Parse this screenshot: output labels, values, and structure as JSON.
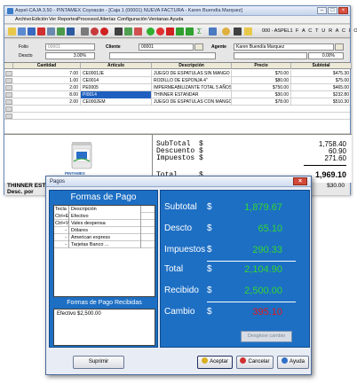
{
  "main_window": {
    "title": "Aspel-CAJA 3.50 - PINTAMEX Coyoacán - [Caja 1 (00001) NUEVA FACTURA - Karen Buendía Marquez]",
    "menu": [
      "Archivo",
      "Edición",
      "Ver",
      "Reportes",
      "Procesos",
      "Utilerías",
      "Configuración",
      "Ventanas",
      "Ayuda"
    ],
    "toolbar": {
      "caja_label": "000 - ASPEL1",
      "doc_type": "F A C T U R A C I O N"
    },
    "form": {
      "folio_label": "Folio",
      "folio_value": "00001",
      "cliente_label": "Cliente",
      "cliente_value": "00001",
      "agente_label": "Agente",
      "agente_value": "Karen Buendía Marquez",
      "descuento_label": "Descto",
      "descuento_value": "3.00%",
      "impuesto_value": "0.00%"
    },
    "grid": {
      "columns": [
        "Cantidad",
        "Artículo",
        "Descripción",
        "Precio",
        "Subtotal"
      ],
      "rows": [
        {
          "cantidad": "7.00",
          "articulo": "CE0001JE",
          "descripcion": "JUEGO DE ESPATULAS SIN MANGO",
          "precio": "$70.00",
          "subtotal": "$475.30"
        },
        {
          "cantidad": "1.00",
          "articulo": "CE0014",
          "descripcion": "RODILLO DE ESPONJA 4\"",
          "precio": "$80.00",
          "subtotal": "$75.00"
        },
        {
          "cantidad": "2.00",
          "articulo": "PE0005",
          "descripcion": "IMPERMEABILIZANTE TOTAL 5 AÑOS",
          "precio": "$750.00",
          "subtotal": "$465.00"
        },
        {
          "cantidad": "8.00",
          "articulo": "PI0014",
          "descripcion": "THINNER ESTANDAR",
          "precio": "$30.00",
          "subtotal": "$232.80"
        },
        {
          "cantidad": "2.00",
          "articulo": "CE0002EM",
          "descripcion": "JUEGO DE ESPATULAS CON MANGO",
          "precio": "$78.00",
          "subtotal": "$510.30"
        }
      ]
    },
    "image_label": "PINTAMEX",
    "totals": {
      "subtotal_label": "SubTotal",
      "subtotal_value": "1,758.40",
      "descuento_label": "Descuento",
      "descuento_value": "60.90",
      "impuestos_label": "Impuestos",
      "impuestos_value": "271.60",
      "total_label": "Total",
      "total_value": "1,969.10",
      "currency": "$"
    },
    "status": {
      "product": "THINNER ESTANDAR",
      "desc": "Desc. por",
      "price": "$30.00"
    }
  },
  "pagos": {
    "title": "Pagos",
    "formas_title": "Formas de Pago",
    "table_head": {
      "tecla": "Tecla",
      "descripcion": "Descripción"
    },
    "formas": [
      {
        "tecla": "Ctrl+E",
        "descripcion": "Efectivo"
      },
      {
        "tecla": "Ctrl+V",
        "descripcion": "Vales despensa"
      },
      {
        "tecla": "-",
        "descripcion": "Dólares"
      },
      {
        "tecla": "-",
        "descripcion": "American express"
      },
      {
        "tecla": "-",
        "descripcion": "Tarjetas Banco ..."
      }
    ],
    "recibidas_title": "Formas de Pago Recibidas",
    "recibidas_entry": "Efectivo $2,500.00",
    "summary": {
      "currency": "$",
      "subtotal_label": "Subtotal",
      "subtotal_value": "1,879.67",
      "descto_label": "Descto",
      "descto_value": "65.10",
      "impuestos_label": "Impuestos",
      "impuestos_value": "290.33",
      "total_label": "Total",
      "total_value": "2,104.90",
      "recibido_label": "Recibido",
      "recibido_value": "2,500.00",
      "cambio_label": "Cambio",
      "cambio_value": "395.10"
    },
    "desglose_label": "Desglose cambio",
    "suprimir_label": "Suprimir",
    "aceptar_label": "Aceptar",
    "cancelar_label": "Cancelar",
    "ayuda_label": "Ayuda",
    "colors": {
      "panel": "#1d6fc4",
      "value_green": "#33d633",
      "cambio_red": "#e01818"
    }
  }
}
